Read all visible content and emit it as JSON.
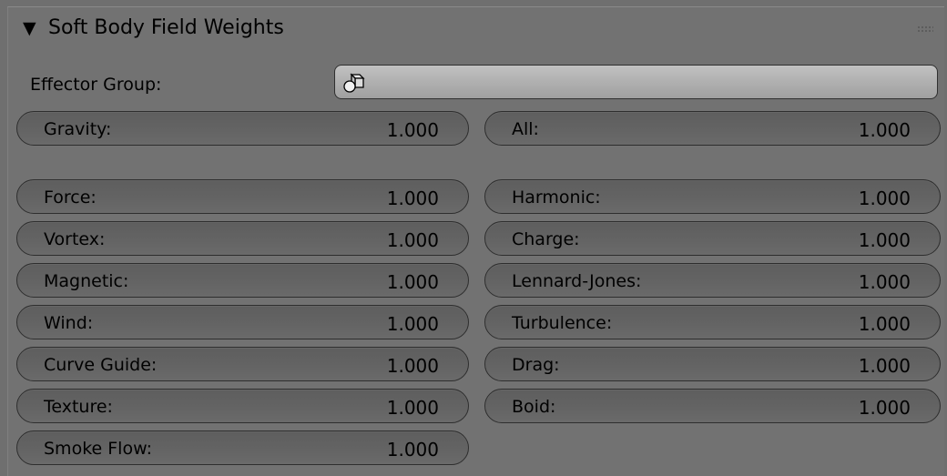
{
  "panel": {
    "title": "Soft Body Field Weights",
    "collapse_glyph": "▼"
  },
  "effector": {
    "label": "Effector Group:",
    "value": "",
    "icon": "group-icon"
  },
  "fields": {
    "gravity": {
      "label": "Gravity:",
      "value": "1.000"
    },
    "all": {
      "label": "All:",
      "value": "1.000"
    },
    "force": {
      "label": "Force:",
      "value": "1.000"
    },
    "harmonic": {
      "label": "Harmonic:",
      "value": "1.000"
    },
    "vortex": {
      "label": "Vortex:",
      "value": "1.000"
    },
    "charge": {
      "label": "Charge:",
      "value": "1.000"
    },
    "magnetic": {
      "label": "Magnetic:",
      "value": "1.000"
    },
    "lennard_jones": {
      "label": "Lennard-Jones:",
      "value": "1.000"
    },
    "wind": {
      "label": "Wind:",
      "value": "1.000"
    },
    "turbulence": {
      "label": "Turbulence:",
      "value": "1.000"
    },
    "curve_guide": {
      "label": "Curve Guide:",
      "value": "1.000"
    },
    "drag": {
      "label": "Drag:",
      "value": "1.000"
    },
    "texture": {
      "label": "Texture:",
      "value": "1.000"
    },
    "boid": {
      "label": "Boid:",
      "value": "1.000"
    },
    "smoke_flow": {
      "label": "Smoke Flow:",
      "value": "1.000"
    }
  }
}
